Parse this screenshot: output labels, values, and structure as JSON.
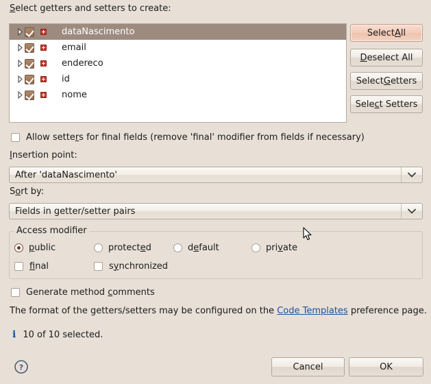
{
  "dialog": {
    "list_label": "Select getters and setters to create:"
  },
  "field_list": {
    "rows": [
      {
        "name": "dataNascimento",
        "checked": true,
        "selected": true,
        "icon": "private-field-icon",
        "expander": "chevron-right-icon"
      },
      {
        "name": "email",
        "checked": true,
        "selected": false,
        "icon": "private-field-icon",
        "expander": "chevron-right-icon"
      },
      {
        "name": "endereco",
        "checked": true,
        "selected": false,
        "icon": "private-field-icon",
        "expander": "chevron-right-icon"
      },
      {
        "name": "id",
        "checked": true,
        "selected": false,
        "icon": "private-field-icon",
        "expander": "chevron-right-icon"
      },
      {
        "name": "nome",
        "checked": true,
        "selected": false,
        "icon": "private-field-icon",
        "expander": "chevron-right-icon"
      }
    ]
  },
  "side_buttons": {
    "select_all": "Select All",
    "deselect_all": "Deselect All",
    "select_getters": "Select Getters",
    "select_setters": "Select Setters"
  },
  "allow_setters": {
    "label": "Allow setters for final fields (remove 'final' modifier from fields if necessary)",
    "checked": false
  },
  "insertion_point": {
    "label": "Insertion point:",
    "value": "After 'dataNascimento'"
  },
  "sort_by": {
    "label": "Sort by:",
    "value": "Fields in getter/setter pairs"
  },
  "access_modifier": {
    "legend": "Access modifier",
    "radios": [
      {
        "label": "public",
        "checked": true
      },
      {
        "label": "protected",
        "checked": false
      },
      {
        "label": "default",
        "checked": false
      },
      {
        "label": "private",
        "checked": false
      }
    ],
    "checkboxes": [
      {
        "label": "final",
        "checked": false
      },
      {
        "label": "synchronized",
        "checked": false
      }
    ]
  },
  "generate_comments": {
    "label": "Generate method comments",
    "checked": false
  },
  "format_note": {
    "prefix": "The format of the getters/setters may be configured on the ",
    "link": "Code Templates",
    "suffix": " preference page."
  },
  "status": {
    "icon": "info-icon",
    "glyph": "i",
    "text": "10 of 10 selected."
  },
  "footer": {
    "help_icon": "help-question-icon",
    "cancel": "Cancel",
    "ok": "OK"
  },
  "colors": {
    "background": "#e8e0d7",
    "selection": "#9d8b80",
    "link": "#1a4fa0",
    "focus_button": "#f2cdbb",
    "field_icon": "#c9352c"
  }
}
